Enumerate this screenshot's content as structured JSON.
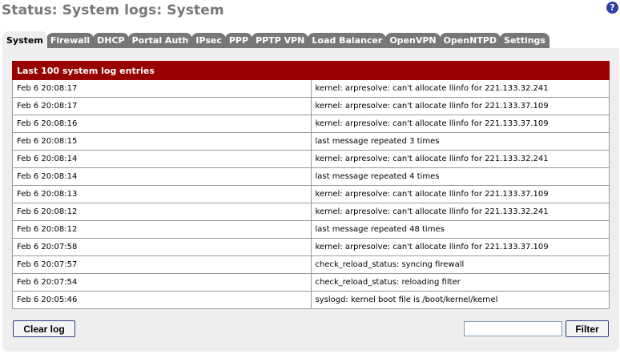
{
  "page": {
    "title": "Status: System logs: System",
    "help_icon": "?"
  },
  "tabs": [
    {
      "label": "System",
      "active": true
    },
    {
      "label": "Firewall",
      "active": false
    },
    {
      "label": "DHCP",
      "active": false
    },
    {
      "label": "Portal Auth",
      "active": false
    },
    {
      "label": "IPsec",
      "active": false
    },
    {
      "label": "PPP",
      "active": false
    },
    {
      "label": "PPTP VPN",
      "active": false
    },
    {
      "label": "Load Balancer",
      "active": false
    },
    {
      "label": "OpenVPN",
      "active": false
    },
    {
      "label": "OpenNTPD",
      "active": false
    },
    {
      "label": "Settings",
      "active": false
    }
  ],
  "log": {
    "header": "Last 100 system log entries",
    "entries": [
      {
        "time": "Feb 6 20:08:17",
        "message": "kernel: arpresolve: can't allocate llinfo for 221.133.32.241"
      },
      {
        "time": "Feb 6 20:08:17",
        "message": "kernel: arpresolve: can't allocate llinfo for 221.133.37.109"
      },
      {
        "time": "Feb 6 20:08:16",
        "message": "kernel: arpresolve: can't allocate llinfo for 221.133.37.109"
      },
      {
        "time": "Feb 6 20:08:15",
        "message": "last message repeated 3 times"
      },
      {
        "time": "Feb 6 20:08:14",
        "message": "kernel: arpresolve: can't allocate llinfo for 221.133.32.241"
      },
      {
        "time": "Feb 6 20:08:14",
        "message": "last message repeated 4 times"
      },
      {
        "time": "Feb 6 20:08:13",
        "message": "kernel: arpresolve: can't allocate llinfo for 221.133.37.109"
      },
      {
        "time": "Feb 6 20:08:12",
        "message": "kernel: arpresolve: can't allocate llinfo for 221.133.32.241"
      },
      {
        "time": "Feb 6 20:08:12",
        "message": "last message repeated 48 times"
      },
      {
        "time": "Feb 6 20:07:58",
        "message": "kernel: arpresolve: can't allocate llinfo for 221.133.37.109"
      },
      {
        "time": "Feb 6 20:07:57",
        "message": "check_reload_status: syncing firewall"
      },
      {
        "time": "Feb 6 20:07:54",
        "message": "check_reload_status: reloading filter"
      },
      {
        "time": "Feb 6 20:05:46",
        "message": "syslogd: kernel boot file is /boot/kernel/kernel"
      }
    ]
  },
  "controls": {
    "clear_label": "Clear log",
    "filter_value": "",
    "filter_label": "Filter"
  },
  "colors": {
    "header_bg": "#990000",
    "tab_bg": "#777777",
    "panel_bg": "#eeeeee",
    "help_icon_bg": "#2f3fa8"
  }
}
